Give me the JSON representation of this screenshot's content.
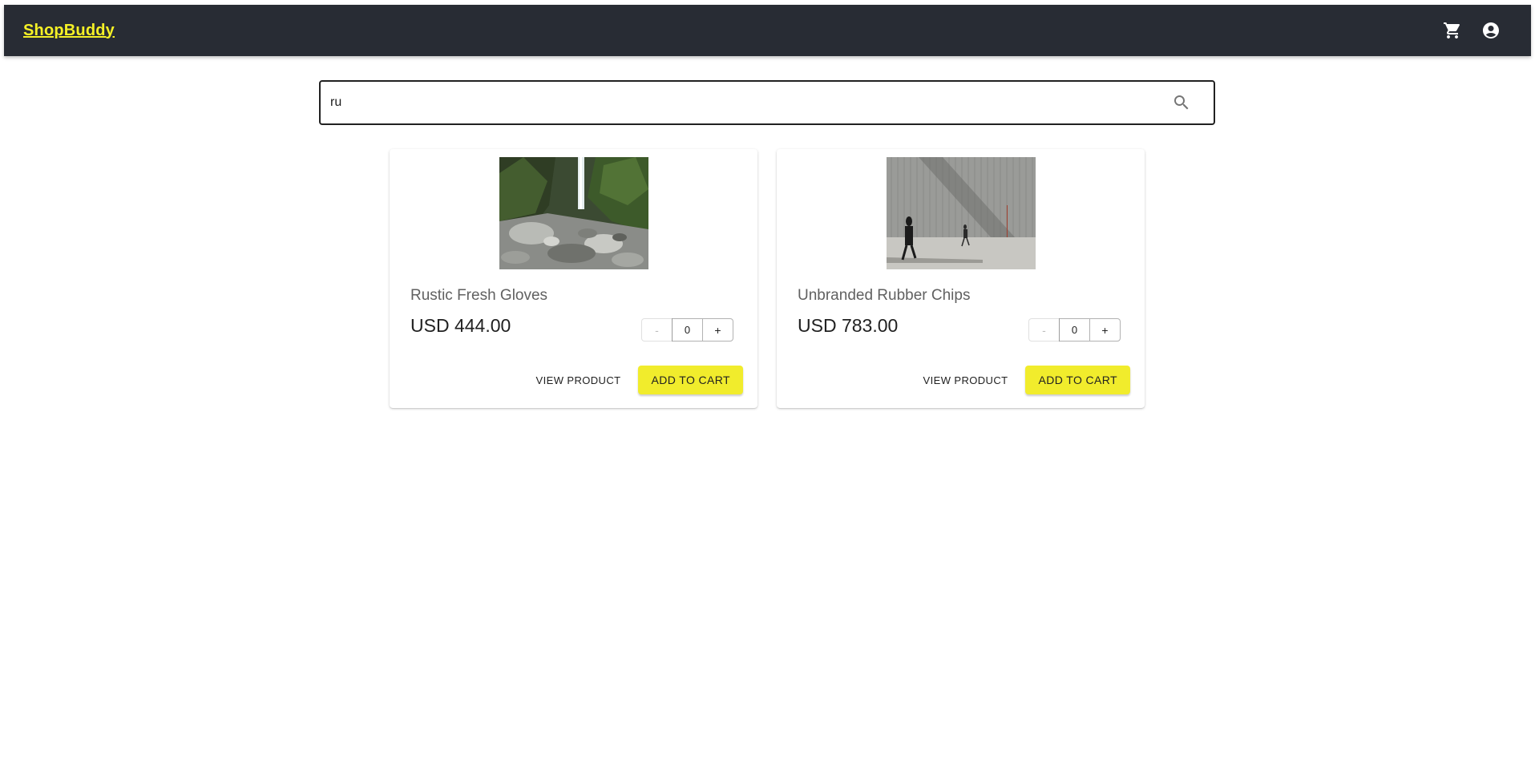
{
  "appbar": {
    "brand": "ShopBuddy",
    "cart_icon": "cart-icon",
    "account_icon": "account-circle-icon",
    "background": "#282c34",
    "brand_color": "#f5f126"
  },
  "search": {
    "value": "ru",
    "icon": "search-icon"
  },
  "products": [
    {
      "name": "Rustic Fresh Gloves",
      "price": "USD 444.00",
      "quantity": "0",
      "minus_label": "-",
      "plus_label": "+",
      "view_label": "VIEW PRODUCT",
      "add_label": "ADD TO CART",
      "image": "waterfall-rocks-photo"
    },
    {
      "name": "Unbranded Rubber Chips",
      "price": "USD 783.00",
      "quantity": "0",
      "minus_label": "-",
      "plus_label": "+",
      "view_label": "VIEW PRODUCT",
      "add_label": "ADD TO CART",
      "image": "people-walking-wall-photo"
    }
  ],
  "accent_color": "#f1ec2c"
}
